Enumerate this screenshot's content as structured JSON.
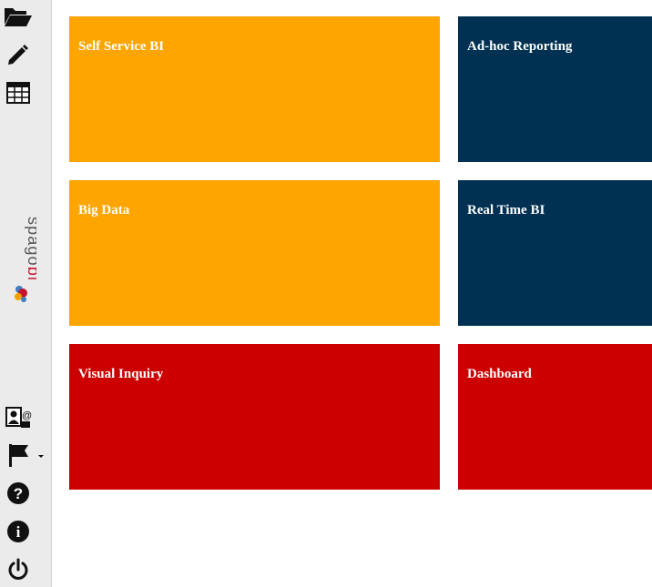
{
  "sidebar": {
    "top_icons": [
      "folder-open-icon",
      "pencil-icon",
      "table-icon"
    ],
    "logo_text": "spagobi",
    "bottom_icons": [
      "contact-card-icon",
      "flag-icon",
      "help-icon",
      "info-icon",
      "power-icon"
    ]
  },
  "tiles": [
    {
      "label": "Self Service BI",
      "color": "#ffa500"
    },
    {
      "label": "Ad-hoc Reporting",
      "color": "#003153"
    },
    {
      "label": "Big Data",
      "color": "#ffa500"
    },
    {
      "label": "Real Time BI",
      "color": "#003153"
    },
    {
      "label": "Visual Inquiry",
      "color": "#cc0000"
    },
    {
      "label": "Dashboard",
      "color": "#cc0000"
    }
  ]
}
